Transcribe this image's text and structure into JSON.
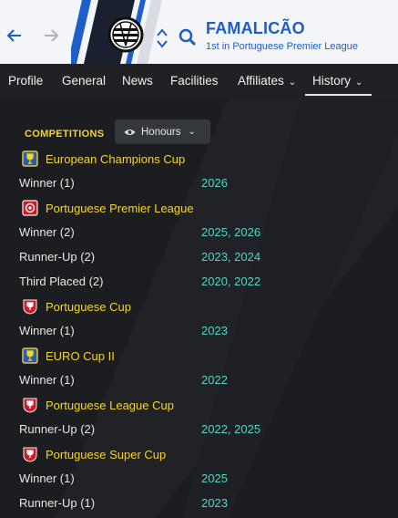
{
  "header": {
    "club_name": "FAMALICÃO",
    "club_subtitle": "1st in Portuguese Premier League",
    "back_icon": "arrow-left-icon",
    "forward_icon": "arrow-right-icon",
    "search_icon": "search-icon",
    "colors": {
      "brand": "#1e5ec8",
      "header_bg": "#f4f5f8"
    }
  },
  "tabs": [
    {
      "label": "Profile"
    },
    {
      "label": "General"
    },
    {
      "label": "News"
    },
    {
      "label": "Facilities"
    },
    {
      "label": "Affiliates",
      "dropdown": true
    },
    {
      "label": "History",
      "dropdown": true,
      "active": true
    }
  ],
  "section": {
    "title": "COMPETITIONS",
    "filter_label": "Honours"
  },
  "competitions": [
    {
      "name": "European Champions Cup",
      "icon": "european-trophy-icon",
      "honours": [
        {
          "label": "Winner  (1)",
          "years": "2026"
        }
      ]
    },
    {
      "name": "Portuguese Premier League",
      "icon": "league-badge-icon",
      "honours": [
        {
          "label": "Winner  (2)",
          "years": "2025, 2026"
        },
        {
          "label": "Runner-Up  (2)",
          "years": "2023, 2024"
        },
        {
          "label": "Third Placed  (2)",
          "years": "2020, 2022"
        }
      ]
    },
    {
      "name": "Portuguese Cup",
      "icon": "cup-badge-icon",
      "honours": [
        {
          "label": "Winner  (1)",
          "years": "2023"
        }
      ]
    },
    {
      "name": "EURO Cup II",
      "icon": "european-trophy-icon",
      "honours": [
        {
          "label": "Winner  (1)",
          "years": "2022"
        }
      ]
    },
    {
      "name": "Portuguese League Cup",
      "icon": "cup-badge-icon",
      "honours": [
        {
          "label": "Runner-Up  (2)",
          "years": "2022, 2025"
        }
      ]
    },
    {
      "name": "Portuguese Super Cup",
      "icon": "cup-badge-icon",
      "honours": [
        {
          "label": "Winner  (1)",
          "years": "2025"
        },
        {
          "label": "Runner-Up  (1)",
          "years": "2023"
        }
      ]
    }
  ],
  "colors": {
    "competition_name": "#f5d42a",
    "years": "#4fd6c4",
    "background": "#1b1d20"
  }
}
